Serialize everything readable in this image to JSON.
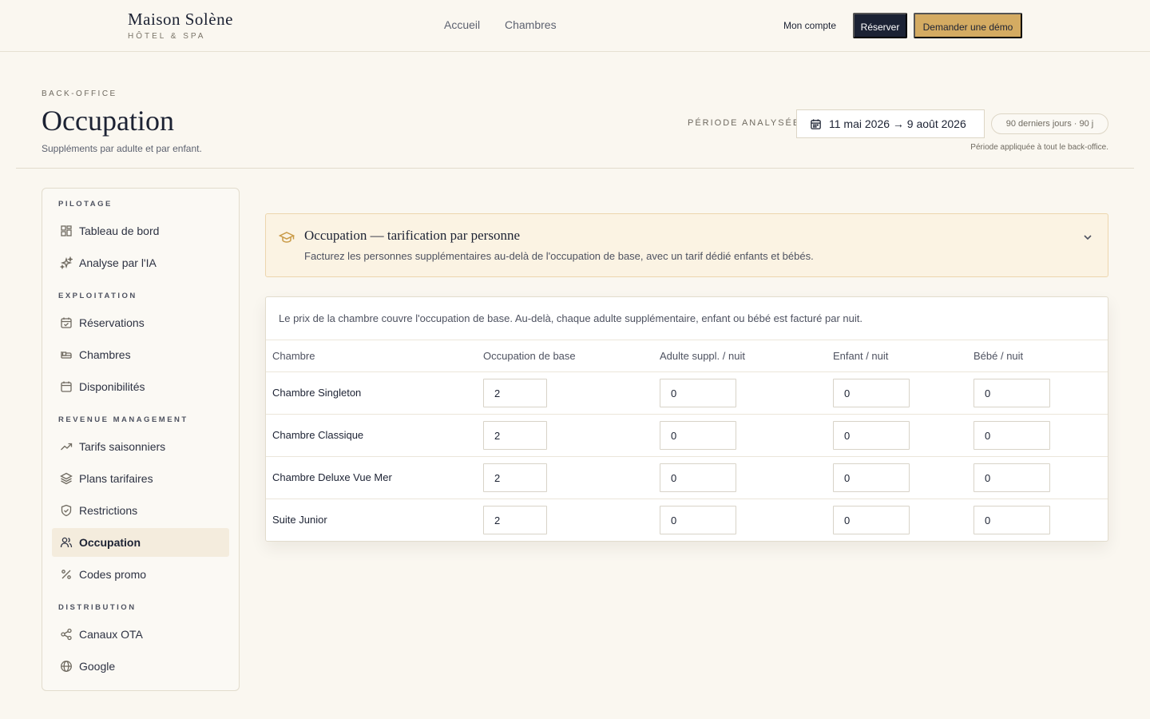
{
  "brand": {
    "name": "Maison Solène",
    "subtitle": "HÔTEL & SPA"
  },
  "nav": {
    "home": "Accueil",
    "rooms": "Chambres"
  },
  "header_actions": {
    "account": "Mon compte",
    "reserve": "Réserver",
    "demo": "Demander une démo"
  },
  "page": {
    "eyebrow": "BACK-OFFICE",
    "title": "Occupation",
    "subtitle": "Suppléments par adulte et par enfant."
  },
  "period": {
    "label": "PÉRIODE ANALYSÉE",
    "range": "11 mai 2026 → 9 août 2026",
    "pill": "90 derniers jours · 90 j",
    "note": "Période appliquée à tout le back-office."
  },
  "sidebar": {
    "sections": [
      "PILOTAGE",
      "EXPLOITATION",
      "REVENUE MANAGEMENT",
      "DISTRIBUTION"
    ],
    "items": [
      {
        "label": "Tableau de bord",
        "icon": "dashboard-icon"
      },
      {
        "label": "Analyse par l'IA",
        "icon": "sparkles-icon"
      },
      {
        "label": "Réservations",
        "icon": "calendar-check-icon"
      },
      {
        "label": "Chambres",
        "icon": "bed-icon"
      },
      {
        "label": "Disponibilités",
        "icon": "calendar-icon"
      },
      {
        "label": "Tarifs saisonniers",
        "icon": "trending-up-icon"
      },
      {
        "label": "Plans tarifaires",
        "icon": "layers-icon"
      },
      {
        "label": "Restrictions",
        "icon": "shield-icon"
      },
      {
        "label": "Occupation",
        "icon": "users-icon",
        "active": true
      },
      {
        "label": "Codes promo",
        "icon": "percent-icon"
      },
      {
        "label": "Canaux OTA",
        "icon": "share-icon"
      },
      {
        "label": "Google",
        "icon": "globe-icon"
      }
    ]
  },
  "info": {
    "title": "Occupation — tarification par personne",
    "description": "Facturez les personnes supplémentaires au-delà de l'occupation de base, avec un tarif dédié enfants et bébés.",
    "icon": "graduation-cap-icon"
  },
  "table": {
    "intro": "Le prix de la chambre couvre l'occupation de base. Au-delà, chaque adulte supplémentaire, enfant ou bébé est facturé par nuit.",
    "headers": [
      "Chambre",
      "Occupation de base",
      "Adulte suppl. / nuit",
      "Enfant / nuit",
      "Bébé / nuit"
    ],
    "rows": [
      {
        "name": "Chambre Singleton",
        "base": "2",
        "adult": "0",
        "child": "0",
        "baby": "0"
      },
      {
        "name": "Chambre Classique",
        "base": "2",
        "adult": "0",
        "child": "0",
        "baby": "0"
      },
      {
        "name": "Chambre Deluxe Vue Mer",
        "base": "2",
        "adult": "0",
        "child": "0",
        "baby": "0"
      },
      {
        "name": "Suite Junior",
        "base": "2",
        "adult": "0",
        "child": "0",
        "baby": "0"
      }
    ]
  },
  "colors": {
    "accent": "#d4ab62",
    "navy": "#1b2234",
    "background": "#faf7f0",
    "active_item": "#f4ecdd"
  }
}
